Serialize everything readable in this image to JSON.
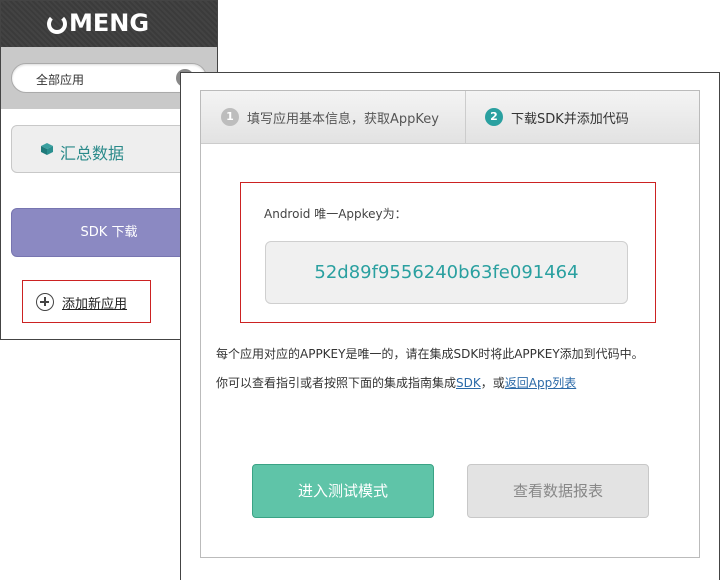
{
  "sidebar": {
    "brand": "MENG",
    "app_select": {
      "value": "全部应用"
    },
    "summary_label": "汇总数据",
    "sdk_download_label": "SDK 下载",
    "add_app_label": "添加新应用"
  },
  "steps": [
    {
      "num": "1",
      "label": "填写应用基本信息，获取AppKey"
    },
    {
      "num": "2",
      "label": "下载SDK并添加代码"
    }
  ],
  "appkey": {
    "caption": "Android 唯一Appkey为：",
    "value": "52d89f9556240b63fe091464"
  },
  "info": {
    "line1": "每个应用对应的APPKEY是唯一的，请在集成SDK时将此APPKEY添加到代码中。",
    "line2_prefix": "你可以查看指引或者按照下面的集成指南集成",
    "line2_link1": "SDK",
    "line2_mid": "，或",
    "line2_link2": "返回App列表"
  },
  "buttons": {
    "test_mode": "进入测试模式",
    "view_report": "查看数据报表"
  },
  "colors": {
    "accent_teal": "#2aa0a0",
    "sdk_purple": "#8b89c2",
    "test_green": "#5fc4a8",
    "highlight_red": "#cc2222"
  }
}
